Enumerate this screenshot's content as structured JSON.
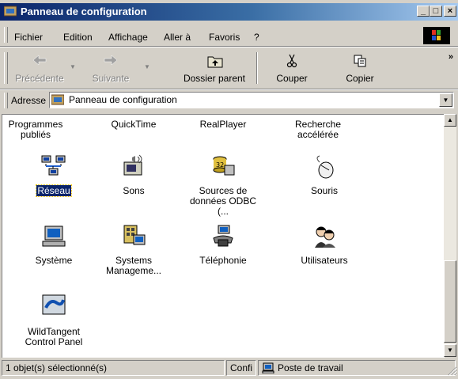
{
  "window": {
    "title": "Panneau de configuration"
  },
  "caption_buttons": {
    "minimize": "_",
    "maximize": "□",
    "close": "×"
  },
  "menu": [
    "Fichier",
    "Edition",
    "Affichage",
    "Aller à",
    "Favoris",
    "?"
  ],
  "toolbar": {
    "back_label": "Précédente",
    "forward_label": "Suivante",
    "up_label": "Dossier parent",
    "cut_label": "Couper",
    "copy_label": "Copier",
    "overflow": "»"
  },
  "address": {
    "label": "Adresse",
    "value": "Panneau de configuration"
  },
  "items": [
    {
      "label": "Programmes publiés",
      "icon": "programs-icon"
    },
    {
      "label": "QuickTime",
      "icon": "quicktime-icon"
    },
    {
      "label": "RealPlayer",
      "icon": "realplayer-icon"
    },
    {
      "label": "Recherche accélérée",
      "icon": "search-icon"
    },
    {
      "label": "Réseau",
      "icon": "network-icon",
      "selected": true
    },
    {
      "label": "Sons",
      "icon": "sound-icon"
    },
    {
      "label": "Sources de données ODBC (...",
      "icon": "odbc-icon"
    },
    {
      "label": "Souris",
      "icon": "mouse-icon"
    },
    {
      "label": "Système",
      "icon": "system-icon"
    },
    {
      "label": "Systems Manageme...",
      "icon": "sms-icon"
    },
    {
      "label": "Téléphonie",
      "icon": "telephony-icon"
    },
    {
      "label": "Utilisateurs",
      "icon": "users-icon"
    },
    {
      "label": "WildTangent Control Panel",
      "icon": "wildtangent-icon"
    }
  ],
  "status": {
    "selection": "1 objet(s) sélectionné(s)",
    "middle": "Confi",
    "zone": "Poste de travail"
  },
  "colors": {
    "selection": "#0a246a",
    "face": "#d4d0c8",
    "title_start": "#0a246a",
    "title_end": "#a6caf0"
  }
}
